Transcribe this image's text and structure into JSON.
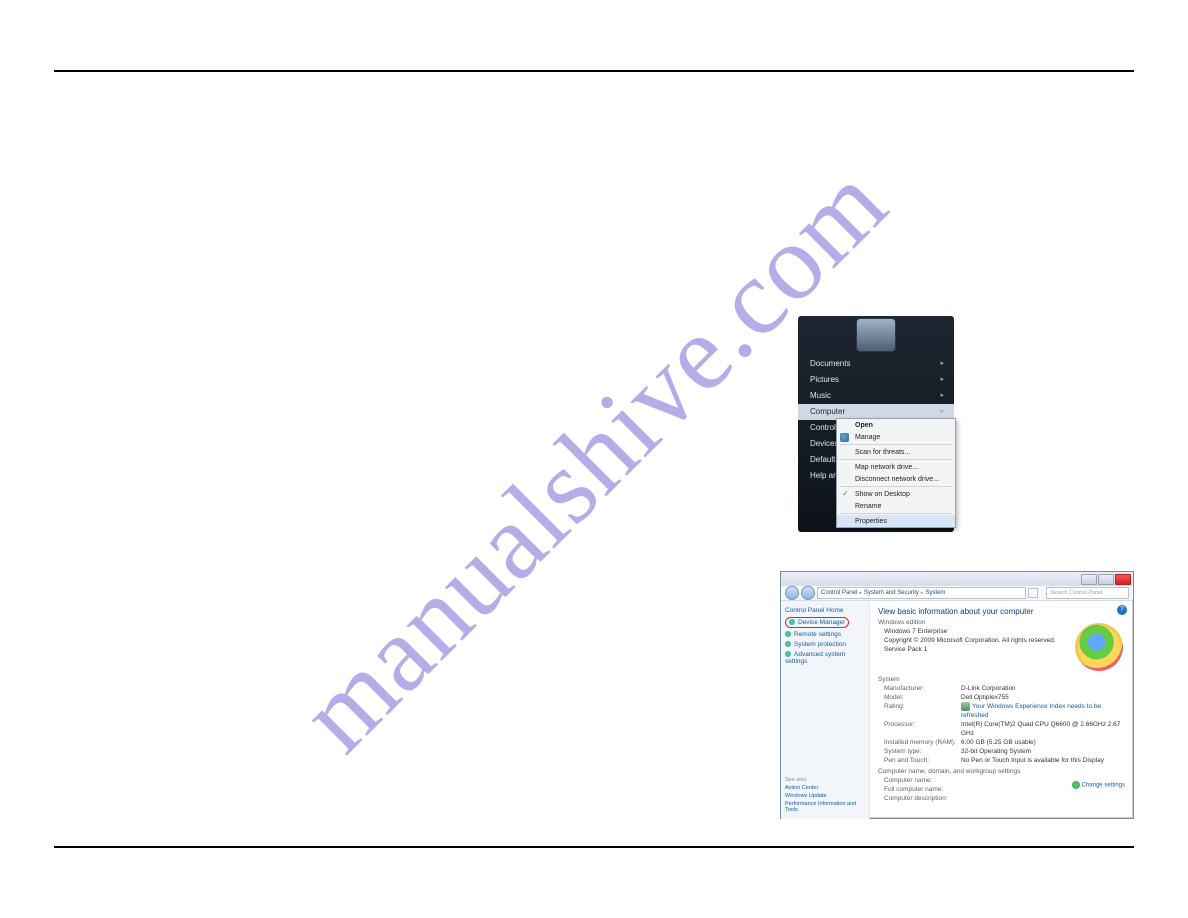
{
  "watermark": "manualshive.com",
  "startpanel": {
    "items": [
      {
        "label": "Documents",
        "arrow": true
      },
      {
        "label": "Pictures",
        "arrow": true
      },
      {
        "label": "Music",
        "arrow": true
      },
      {
        "label": "Computer",
        "arrow": true,
        "highlight": true
      },
      {
        "label": "Control Panel",
        "arrow": true
      },
      {
        "label": "Devices and Printers",
        "arrow": true
      },
      {
        "label": "Default Programs",
        "arrow": true
      },
      {
        "label": "Help and Support",
        "arrow": true
      }
    ]
  },
  "contextmenu": {
    "open": "Open",
    "manage": "Manage",
    "scan": "Scan for threats...",
    "map": "Map network drive...",
    "disc": "Disconnect network drive...",
    "desk": "Show on Desktop",
    "rename": "Rename",
    "props": "Properties"
  },
  "syswin": {
    "breadcrumb": [
      "Control Panel",
      "System and Security",
      "System"
    ],
    "search_placeholder": "Search Control Panel",
    "left": {
      "home": "Control Panel Home",
      "device_manager": "Device Manager",
      "remote": "Remote settings",
      "protect": "System protection",
      "adv": "Advanced system settings",
      "seealso": "See also",
      "action": "Action Center",
      "wupdate": "Windows Update",
      "perf": "Performance Information and Tools"
    },
    "main": {
      "heading": "View basic information about your computer",
      "edition_head": "Windows edition",
      "edition": "Windows 7 Enterprise",
      "copy": "Copyright © 2009 Microsoft Corporation. All rights reserved.",
      "sp": "Service Pack 1",
      "system_head": "System",
      "manu_k": "Manufacturer:",
      "manu_v": "D-Link Corporation",
      "model_k": "Model:",
      "model_v": "Dell Optiplex755",
      "rating_k": "Rating:",
      "rating_v": "Your Windows Experience Index needs to be refreshed",
      "proc_k": "Processor:",
      "proc_v": "Intel(R) Core(TM)2 Quad CPU   Q6600  @ 2.66GHz  2.67 GHz",
      "ram_k": "Installed memory (RAM):",
      "ram_v": "6.00 GB (5.25 GB usable)",
      "systype_k": "System type:",
      "systype_v": "32-bit Operating System",
      "pen_k": "Pen and Touch:",
      "pen_v": "No Pen or Touch Input is available for this Display",
      "cdw_head": "Computer name, domain, and workgroup settings",
      "cname_k": "Computer name:",
      "cname_v": "",
      "fname_k": "Full computer name:",
      "fname_v": "",
      "cdesc_k": "Computer description:",
      "cdesc_v": "",
      "change": "Change settings"
    }
  }
}
